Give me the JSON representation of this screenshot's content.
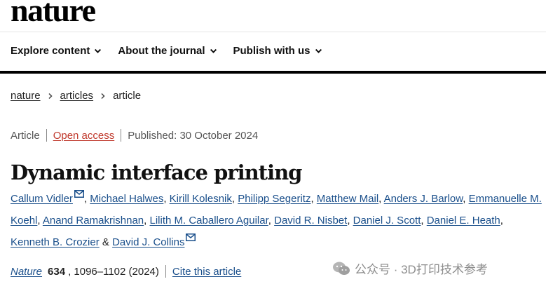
{
  "masthead": {
    "logo_text": "nature"
  },
  "nav": {
    "items": [
      {
        "label": "Explore content"
      },
      {
        "label": "About the journal"
      },
      {
        "label": "Publish with us"
      }
    ]
  },
  "breadcrumb": {
    "items": [
      "nature",
      "articles",
      "article"
    ]
  },
  "meta": {
    "type": "Article",
    "access": "Open access",
    "published": "Published: 30 October 2024"
  },
  "article": {
    "title": "Dynamic interface printing"
  },
  "authors": {
    "list": [
      "Callum Vidler",
      "Michael Halwes",
      "Kirill Kolesnik",
      "Philipp Segeritz",
      "Matthew Mail",
      "Anders J. Barlow",
      "Emmanuelle M. Koehl",
      "Anand Ramakrishnan",
      "Lilith M. Caballero Aguilar",
      "David R. Nisbet",
      "Daniel J. Scott",
      "Daniel E. Heath",
      "Kenneth B. Crozier",
      "David J. Collins"
    ],
    "separator": ",",
    "final_joiner": "&",
    "corresponding_icon": "mail-icon"
  },
  "citation": {
    "journal": "Nature",
    "volume": "634",
    "pages_year": ", 1096–1102 (2024)",
    "cite_label": "Cite this article"
  },
  "watermark": {
    "text": "公众号 · 3D打印技术参考",
    "icon": "wechat-icon"
  },
  "colors": {
    "link": "#1a4f8b",
    "open_access": "#c0382b",
    "rule": "#000000"
  }
}
